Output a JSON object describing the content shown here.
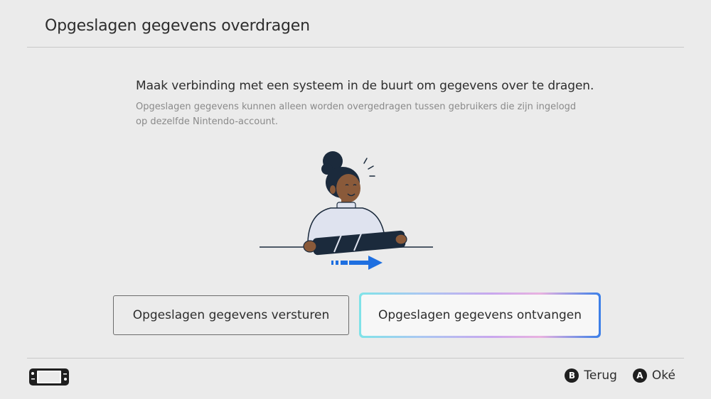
{
  "header": {
    "title": "Opgeslagen gegevens overdragen"
  },
  "main": {
    "heading": "Maak verbinding met een systeem in de buurt om gegevens over te dragen.",
    "description": "Opgeslagen gegevens kunnen alleen worden overgedragen tussen gebruikers die zijn ingelogd op dezelfde Nintendo-account."
  },
  "buttons": {
    "send_label": "Opgeslagen gegevens versturen",
    "receive_label": "Opgeslagen gegevens ontvangen"
  },
  "footer": {
    "back": {
      "key": "B",
      "label": "Terug"
    },
    "ok": {
      "key": "A",
      "label": "Oké"
    },
    "console_icon": "handheld-console-icon"
  },
  "colors": {
    "background": "#ebebeb",
    "arrow_blue": "#1e6fe0",
    "console_dark": "#1b2a3c",
    "focus_gradient_end": "#3b7fe8"
  }
}
